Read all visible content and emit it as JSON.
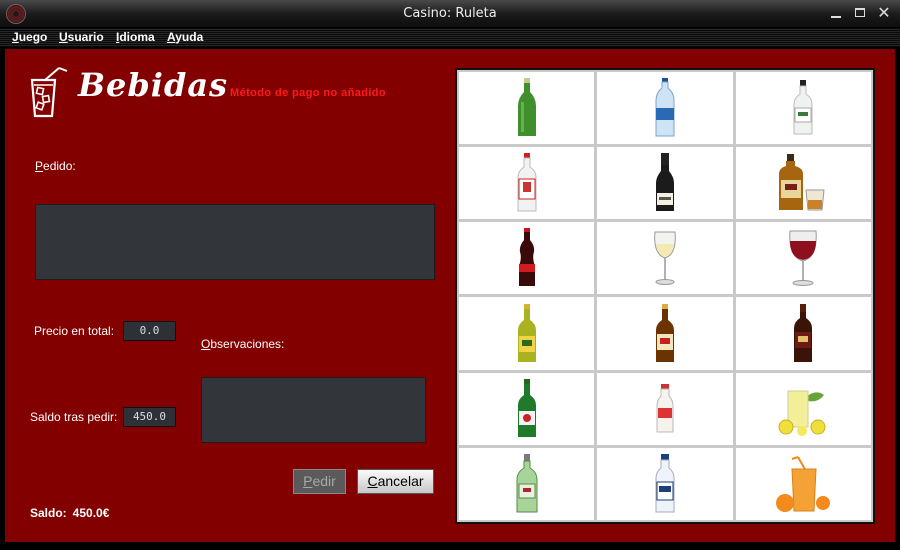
{
  "window": {
    "title": "Casino: Ruleta"
  },
  "menu": {
    "items": [
      "Juego",
      "Usuario",
      "Idioma",
      "Ayuda"
    ]
  },
  "header": {
    "title": "Bebidas",
    "warning": "Método de pago no añadido"
  },
  "form": {
    "pedido_label": "Pedido:",
    "precio_label": "Precio en total:",
    "precio_value": "0.0",
    "observaciones_label": "Observaciones:",
    "saldo_tras_label": "Saldo tras pedir:",
    "saldo_tras_value": "450.0"
  },
  "buttons": {
    "pedir": "Pedir",
    "cancelar": "Cancelar"
  },
  "footer": {
    "saldo_label": "Saldo:",
    "saldo_value": "450.0€"
  },
  "drinks": [
    {
      "icon": "green-bottle-icon"
    },
    {
      "icon": "water-bottle-icon"
    },
    {
      "icon": "white-rum-bottle-icon"
    },
    {
      "icon": "gin-bottle-icon"
    },
    {
      "icon": "champagne-bottle-icon"
    },
    {
      "icon": "whisky-bottle-glass-icon"
    },
    {
      "icon": "cola-bottle-icon"
    },
    {
      "icon": "white-wine-glass-icon"
    },
    {
      "icon": "red-wine-glass-icon"
    },
    {
      "icon": "lager-bottle-icon"
    },
    {
      "icon": "amber-beer-bottle-icon"
    },
    {
      "icon": "dark-rum-bottle-icon"
    },
    {
      "icon": "green-beer-bottle-icon"
    },
    {
      "icon": "milk-bottle-icon"
    },
    {
      "icon": "lemonade-glass-icon"
    },
    {
      "icon": "tanqueray-bottle-icon"
    },
    {
      "icon": "tonic-bottle-icon"
    },
    {
      "icon": "orange-juice-icon"
    }
  ],
  "colors": {
    "panel": "#830000",
    "warning": "#ff1a1a",
    "field": "#32363b"
  }
}
